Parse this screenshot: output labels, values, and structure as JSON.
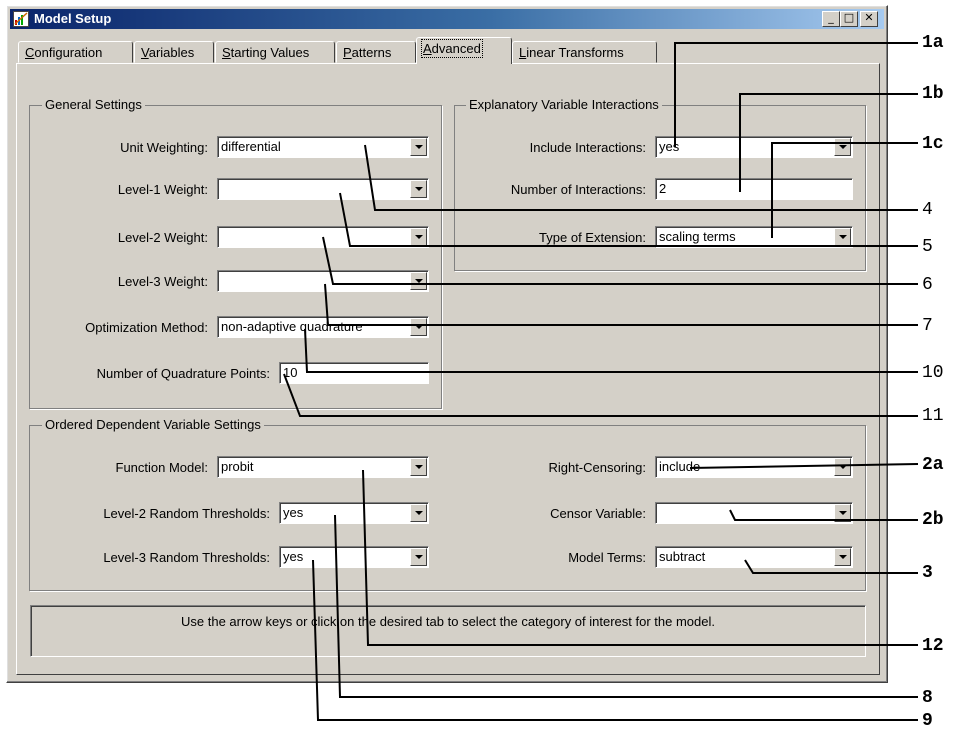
{
  "window": {
    "title": "Model Setup",
    "controls": {
      "minimize": "_",
      "maximize": "□",
      "close": "✕"
    }
  },
  "tabs": [
    {
      "pre": "",
      "accel": "C",
      "post": "onfiguration",
      "active": false
    },
    {
      "pre": "",
      "accel": "V",
      "post": "ariables",
      "active": false
    },
    {
      "pre": "",
      "accel": "S",
      "post": "tarting Values",
      "active": false
    },
    {
      "pre": "",
      "accel": "P",
      "post": "atterns",
      "active": false
    },
    {
      "pre": "",
      "accel": "A",
      "post": "dvanced",
      "active": true
    },
    {
      "pre": "",
      "accel": "L",
      "post": "inear Transforms",
      "active": false
    }
  ],
  "general": {
    "title": "General Settings",
    "unit_weighting": {
      "label": "Unit Weighting:",
      "value": "differential"
    },
    "level1_weight": {
      "label": "Level-1 Weight:",
      "value": ""
    },
    "level2_weight": {
      "label": "Level-2 Weight:",
      "value": ""
    },
    "level3_weight": {
      "label": "Level-3 Weight:",
      "value": ""
    },
    "optimization": {
      "label": "Optimization Method:",
      "value": "non-adaptive quadrature"
    },
    "quadrature_points": {
      "label": "Number of Quadrature Points:",
      "value": "10"
    }
  },
  "interactions": {
    "title": "Explanatory Variable Interactions",
    "include": {
      "label": "Include Interactions:",
      "value": "yes"
    },
    "number": {
      "label": "Number of Interactions:",
      "value": "2"
    },
    "extension": {
      "label": "Type of Extension:",
      "value": "scaling terms"
    }
  },
  "ordered": {
    "title": "Ordered Dependent Variable Settings",
    "function_model": {
      "label": "Function Model:",
      "value": "probit"
    },
    "l2_thresholds": {
      "label": "Level-2 Random Thresholds:",
      "value": "yes"
    },
    "l3_thresholds": {
      "label": "Level-3 Random Thresholds:",
      "value": "yes"
    },
    "right_censoring": {
      "label": "Right-Censoring:",
      "value": "include"
    },
    "censor_variable": {
      "label": "Censor Variable:",
      "value": ""
    },
    "model_terms": {
      "label": "Model Terms:",
      "value": "subtract"
    }
  },
  "status": "Use the arrow keys or click on the desired tab to select the category of interest for the model.",
  "callouts": {
    "c1a": "1a",
    "c1b": "1b",
    "c1c": "1c",
    "c4": "4",
    "c5": "5",
    "c6": "6",
    "c7": "7",
    "c10": "10",
    "c11": "11",
    "c2a": "2a",
    "c2b": "2b",
    "c3": "3",
    "c12": "12",
    "c8": "8",
    "c9": "9"
  }
}
